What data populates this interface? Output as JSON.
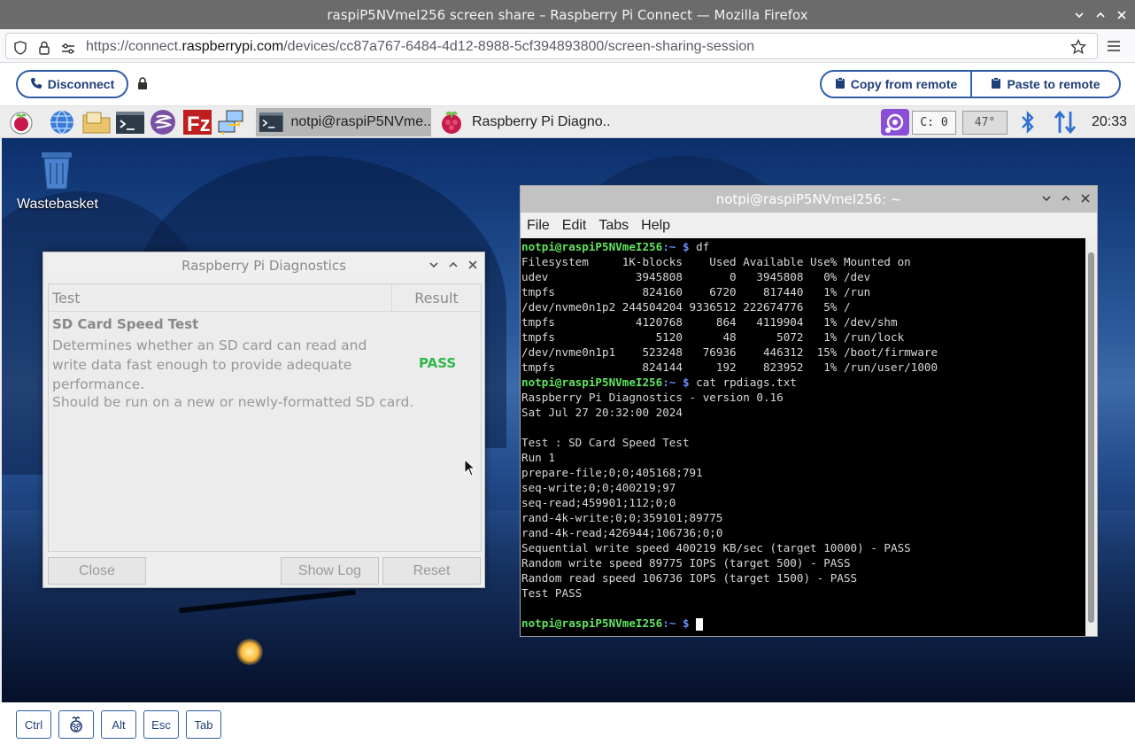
{
  "browser": {
    "window_title": "raspiP5NVmeI256 screen share – Raspberry Pi Connect — Mozilla Firefox",
    "url_prefix": "https://connect.",
    "url_domain": "raspberrypi.com",
    "url_path": "/devices/cc87a767-6484-4d12-8988-5cf394893800/screen-sharing-session"
  },
  "connect": {
    "disconnect_label": "Disconnect",
    "copy_label": "Copy from remote",
    "paste_label": "Paste to remote",
    "accent": "#2f5ea8"
  },
  "taskbar": {
    "tasks": [
      {
        "label": "notpi@raspiP5NVme.."
      },
      {
        "label": "Raspberry Pi Diagno.."
      }
    ],
    "cpu_label": "C:  0",
    "temp_label": "47°",
    "clock": "20:33"
  },
  "desktop": {
    "trash_label": "Wastebasket"
  },
  "diagnostics": {
    "title": "Raspberry Pi Diagnostics",
    "col_test": "Test",
    "col_result": "Result",
    "test_name": "SD Card Speed Test",
    "test_desc": "Determines whether an SD card can read and write data fast enough to provide adequate performance.",
    "test_note": "Should be run on a new or newly-formatted SD card.",
    "test_result": "PASS",
    "close_label": "Close",
    "showlog_label": "Show Log",
    "reset_label": "Reset",
    "pass_color": "#2fb84a"
  },
  "terminal": {
    "title": "notpi@raspiP5NVmeI256: ~",
    "menu": [
      "File",
      "Edit",
      "Tabs",
      "Help"
    ],
    "prompt_user": "notpi@raspiP5NVmeI256",
    "prompt_path": ":~",
    "prompt_sym": " $ ",
    "cmd1": "df",
    "df_lines": [
      "Filesystem     1K-blocks    Used Available Use% Mounted on",
      "udev             3945808       0   3945808   0% /dev",
      "tmpfs             824160    6720    817440   1% /run",
      "/dev/nvme0n1p2 244504204 9336512 222674776   5% /",
      "tmpfs            4120768     864   4119904   1% /dev/shm",
      "tmpfs               5120      48      5072   1% /run/lock",
      "/dev/nvme0n1p1    523248   76936    446312  15% /boot/firmware",
      "tmpfs             824144     192    823952   1% /run/user/1000"
    ],
    "cmd2": "cat rpdiags.txt",
    "cat_lines": [
      "Raspberry Pi Diagnostics - version 0.16",
      "Sat Jul 27 20:32:00 2024",
      "",
      "Test : SD Card Speed Test",
      "Run 1",
      "prepare-file;0;0;405168;791",
      "seq-write;0;0;400219;97",
      "seq-read;459901;112;0;0",
      "rand-4k-write;0;0;359101;89775",
      "rand-4k-read;426944;106736;0;0",
      "Sequential write speed 400219 KB/sec (target 10000) - PASS",
      "Random write speed 89775 IOPS (target 500) - PASS",
      "Random read speed 106736 IOPS (target 1500) - PASS",
      "Test PASS",
      ""
    ]
  },
  "keys": [
    "Ctrl",
    "Alt",
    "Esc",
    "Tab"
  ]
}
